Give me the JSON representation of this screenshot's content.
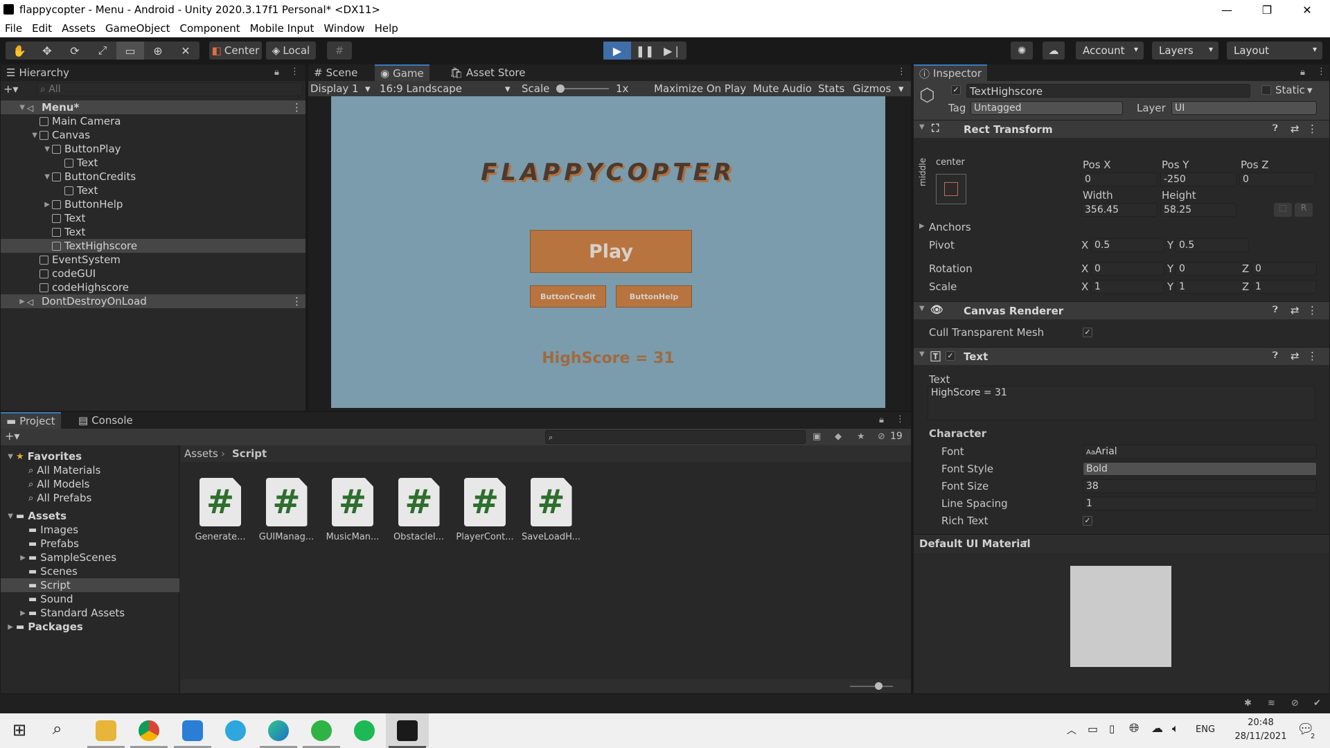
{
  "window": {
    "title": "flappycopter - Menu - Android - Unity 2020.3.17f1 Personal* <DX11>",
    "minimize": "—",
    "maximize": "❐",
    "close": "✕"
  },
  "menu": [
    "File",
    "Edit",
    "Assets",
    "GameObject",
    "Component",
    "Mobile Input",
    "Window",
    "Help"
  ],
  "toolbar": {
    "pivot": "Center",
    "space": "Local",
    "account": "Account",
    "layers": "Layers",
    "layout": "Layout"
  },
  "hierarchy": {
    "tab": "Hierarchy",
    "search_placeholder": "All",
    "items": [
      {
        "label": "Menu*",
        "depth": 0
      },
      {
        "label": "Main Camera",
        "depth": 1
      },
      {
        "label": "Canvas",
        "depth": 1
      },
      {
        "label": "ButtonPlay",
        "depth": 2
      },
      {
        "label": "Text",
        "depth": 3
      },
      {
        "label": "ButtonCredits",
        "depth": 2
      },
      {
        "label": "Text",
        "depth": 3
      },
      {
        "label": "ButtonHelp",
        "depth": 2
      },
      {
        "label": "Text",
        "depth": 2
      },
      {
        "label": "Text",
        "depth": 2
      },
      {
        "label": "TextHighscore",
        "depth": 2
      },
      {
        "label": "EventSystem",
        "depth": 1
      },
      {
        "label": "codeGUI",
        "depth": 1
      },
      {
        "label": "codeHighscore",
        "depth": 1
      },
      {
        "label": "DontDestroyOnLoad",
        "depth": 0
      }
    ]
  },
  "center_tabs": {
    "scene": "Scene",
    "game": "Game",
    "asset_store": "Asset Store"
  },
  "game_bar": {
    "display": "Display 1",
    "aspect": "16:9 Landscape",
    "scale_label": "Scale",
    "scale_value": "1x",
    "maximize": "Maximize On Play",
    "mute": "Mute Audio",
    "stats": "Stats",
    "gizmos": "Gizmos"
  },
  "game": {
    "title": "FLAPPYCOPTER",
    "play": "Play",
    "credit": "ButtonCredit",
    "help": "ButtonHelp",
    "highscore": "HighScore = 31",
    "bg": "#7b9cac",
    "button_color": "#b8743f"
  },
  "project": {
    "tab_project": "Project",
    "tab_console": "Console",
    "count": "19",
    "breadcrumb_root": "Assets",
    "breadcrumb_leaf": "Script",
    "favorites": "Favorites",
    "fav_items": [
      "All Materials",
      "All Models",
      "All Prefabs"
    ],
    "assets": "Assets",
    "folders": [
      "Images",
      "Prefabs",
      "SampleScenes",
      "Scenes",
      "Script",
      "Sound",
      "Standard Assets"
    ],
    "packages": "Packages",
    "scripts": [
      "Generate...",
      "GUIManag...",
      "MusicMan...",
      "Obstaclel...",
      "PlayerCont...",
      "SaveLoadH..."
    ]
  },
  "inspector": {
    "tab": "Inspector",
    "object_name": "TextHighscore",
    "static": "Static",
    "tag_label": "Tag",
    "tag": "Untagged",
    "layer_label": "Layer",
    "layer": "UI",
    "rect": {
      "title": "Rect Transform",
      "anchor_top": "center",
      "anchor_side": "middle",
      "posx_l": "Pos X",
      "posy_l": "Pos Y",
      "posz_l": "Pos Z",
      "posx": "0",
      "posy": "-250",
      "posz": "0",
      "width_l": "Width",
      "height_l": "Height",
      "width": "356.45",
      "height": "58.25",
      "anchors": "Anchors",
      "pivot": "Pivot",
      "pivot_x": "0.5",
      "pivot_y": "0.5",
      "rotation": "Rotation",
      "rot_x": "0",
      "rot_y": "0",
      "rot_z": "0",
      "scale": "Scale",
      "sc_x": "1",
      "sc_y": "1",
      "sc_z": "1"
    },
    "canvas_renderer": {
      "title": "Canvas Renderer",
      "cull": "Cull Transparent Mesh"
    },
    "text": {
      "title": "Text",
      "text_label": "Text",
      "text_value": "HighScore = 31",
      "character": "Character",
      "font_l": "Font",
      "font": "Arial",
      "style_l": "Font Style",
      "style": "Bold",
      "size_l": "Font Size",
      "size": "38",
      "spacing_l": "Line Spacing",
      "spacing": "1",
      "rich_l": "Rich Text"
    },
    "material": "Default UI Material"
  },
  "taskbar": {
    "time": "20:48",
    "date": "28/11/2021",
    "lang": "ENG",
    "notif": "2"
  }
}
